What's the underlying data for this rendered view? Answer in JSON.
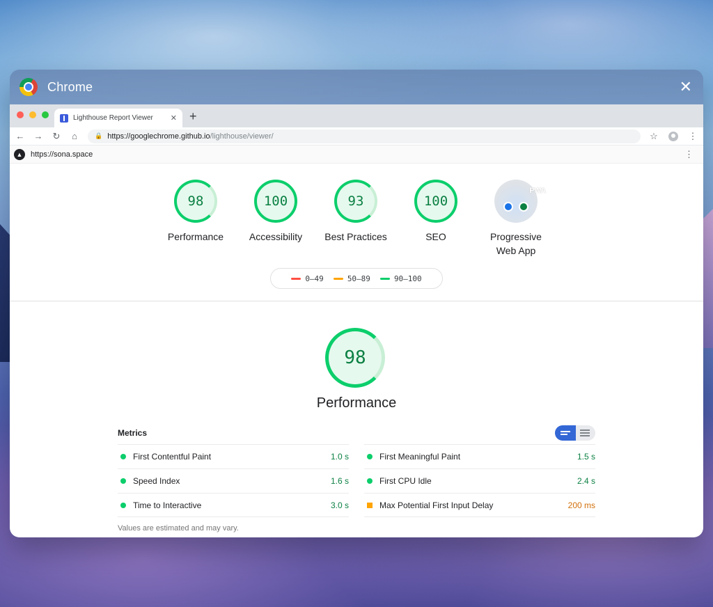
{
  "window": {
    "app_title": "Chrome"
  },
  "browser": {
    "tab_title": "Lighthouse Report Viewer",
    "url_host": "https://googlechrome.github.io",
    "url_path": "/lighthouse/viewer/"
  },
  "report": {
    "audited_url": "https://sona.space",
    "categories": [
      {
        "label": "Performance",
        "score": "98"
      },
      {
        "label": "Accessibility",
        "score": "100"
      },
      {
        "label": "Best Practices",
        "score": "93"
      },
      {
        "label": "SEO",
        "score": "100"
      }
    ],
    "pwa": {
      "label_line1": "Progressive",
      "label_line2": "Web App",
      "badge_text": "PWA"
    },
    "legend": [
      {
        "range": "0–49",
        "color": "#ff4e42"
      },
      {
        "range": "50–89",
        "color": "#ffa400"
      },
      {
        "range": "90–100",
        "color": "#0cce6b"
      }
    ],
    "performance": {
      "score": "98",
      "label": "Performance",
      "metrics_title": "Metrics",
      "metrics_left": [
        {
          "name": "First Contentful Paint",
          "value": "1.0 s",
          "status": "pass"
        },
        {
          "name": "Speed Index",
          "value": "1.6 s",
          "status": "pass"
        },
        {
          "name": "Time to Interactive",
          "value": "3.0 s",
          "status": "pass"
        }
      ],
      "metrics_right": [
        {
          "name": "First Meaningful Paint",
          "value": "1.5 s",
          "status": "pass"
        },
        {
          "name": "First CPU Idle",
          "value": "2.4 s",
          "status": "pass"
        },
        {
          "name": "Max Potential First Input Delay",
          "value": "200 ms",
          "status": "average"
        }
      ],
      "footnote": "Values are estimated and may vary."
    }
  }
}
